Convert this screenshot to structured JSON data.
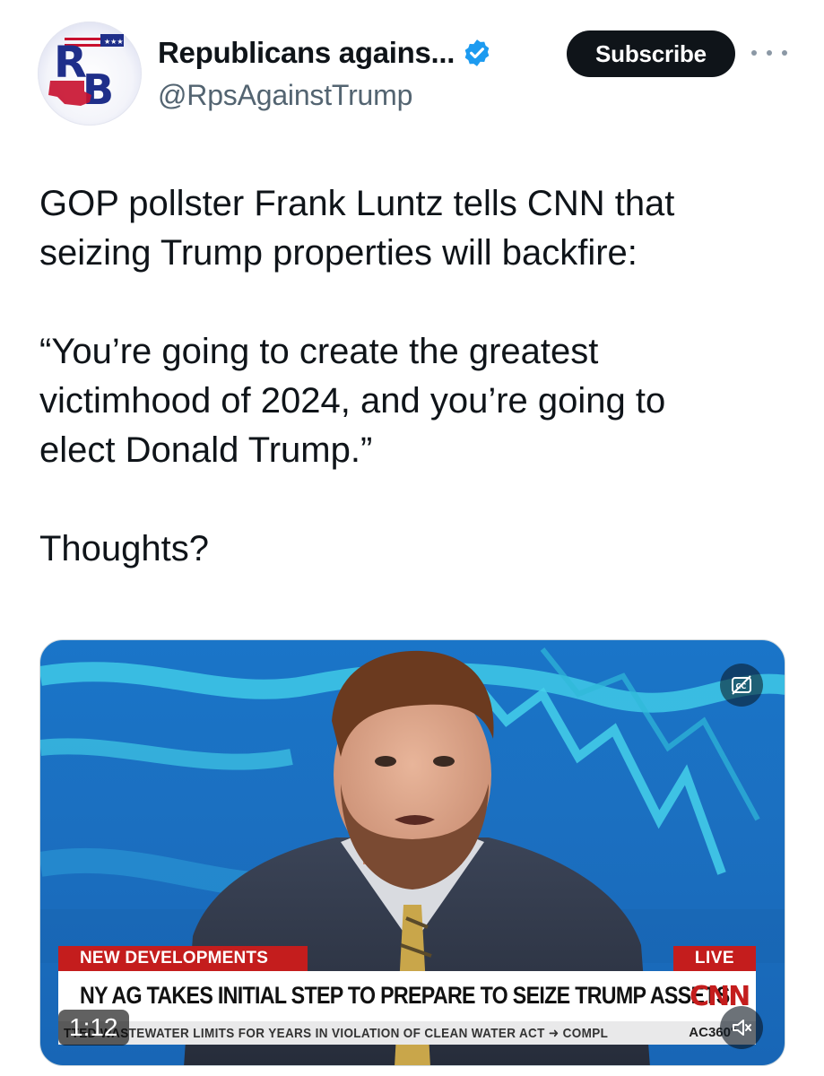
{
  "author": {
    "display_name": "Republicans agains...",
    "handle": "@RpsAgainstTrump",
    "avatar_monogram": "RB",
    "verified": true
  },
  "actions": {
    "subscribe_label": "Subscribe",
    "more_icon": "more-horizontal-icon"
  },
  "tweet": {
    "lines": [
      "GOP pollster Frank Luntz tells CNN that\nseizing Trump properties will backfire:",
      "“You’re going to create the greatest\nvictimhood of 2024, and you’re going to\nelect Donald Trump.”",
      "Thoughts?"
    ]
  },
  "video": {
    "timestamp": "1:12",
    "captions_icon": "closed-captions-icon",
    "mute_icon": "muted-speaker-icon",
    "chyron": {
      "tag": "NEW DEVELOPMENTS",
      "live": "LIVE",
      "headline": "NY AG TAKES INITIAL STEP TO PREPARE TO SEIZE TRUMP ASSETS",
      "network": "CNN",
      "crawl": "TTED WASTEWATER LIMITS FOR YEARS IN VIOLATION OF CLEAN WATER ACT  ➜ COMPL",
      "show": "AC360°"
    }
  },
  "colors": {
    "verified_blue": "#1d9bf0",
    "cnn_red": "#c41d1d",
    "video_blue": "#1a75c8"
  }
}
